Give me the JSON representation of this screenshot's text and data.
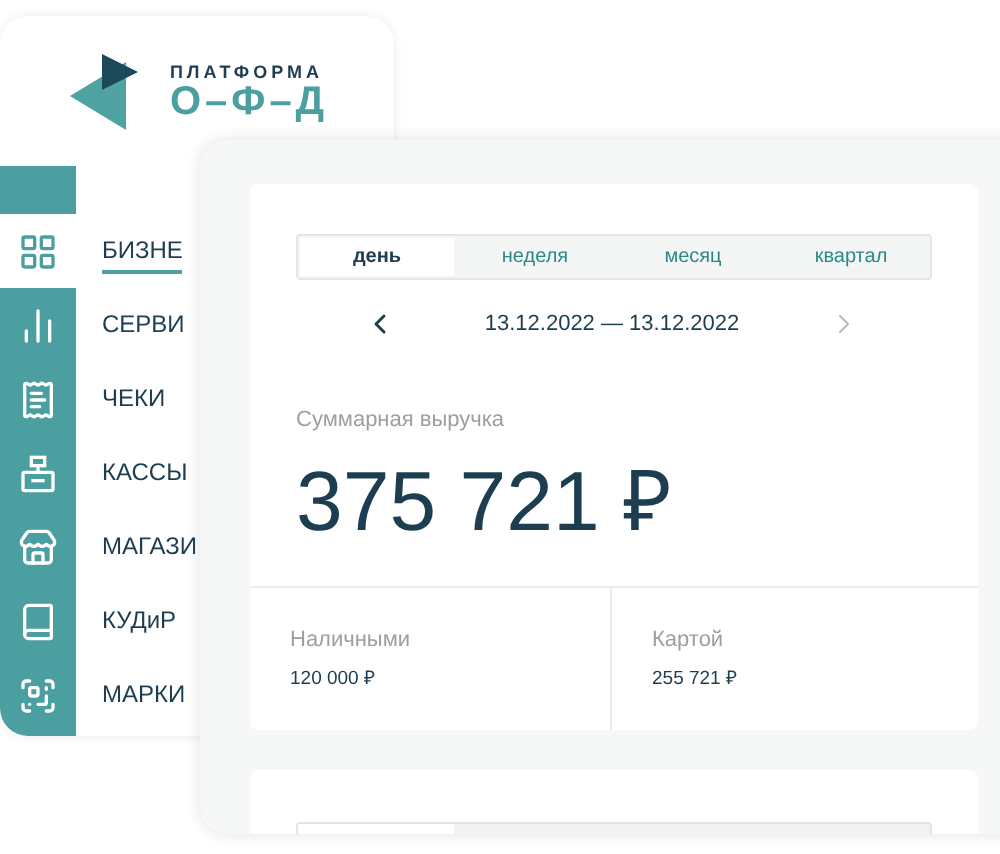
{
  "logo": {
    "top": "ПЛАТФОРМА",
    "bottom": "О–Ф–Д"
  },
  "sidebar": {
    "items": [
      {
        "label": "БИЗНЕ",
        "kind": "grid",
        "selected": true
      },
      {
        "label": "СЕРВИ",
        "kind": "chart",
        "selected": false
      },
      {
        "label": "ЧЕКИ",
        "kind": "receipt",
        "selected": false
      },
      {
        "label": "КАССЫ",
        "kind": "register",
        "selected": false
      },
      {
        "label": "МАГАЗИ",
        "kind": "store",
        "selected": false
      },
      {
        "label": "КУДиР",
        "kind": "book",
        "selected": false
      },
      {
        "label": "МАРКИ",
        "kind": "scan",
        "selected": false
      }
    ]
  },
  "period_tabs": [
    {
      "label": "день",
      "selected": true
    },
    {
      "label": "неделя",
      "selected": false
    },
    {
      "label": "месяц",
      "selected": false
    },
    {
      "label": "квартал",
      "selected": false
    }
  ],
  "date_range": {
    "text": "13.12.2022 — 13.12.2022",
    "prev_disabled": false,
    "next_disabled": true
  },
  "revenue": {
    "label": "Суммарная выручка",
    "value": "375 721 ₽"
  },
  "breakdown": [
    {
      "label": "Наличными",
      "value": "120 000 ₽"
    },
    {
      "label": "Картой",
      "value": "255 721 ₽"
    }
  ],
  "second_card": {
    "tabs": [
      {
        "selected": true
      },
      {
        "selected": false
      }
    ]
  }
}
